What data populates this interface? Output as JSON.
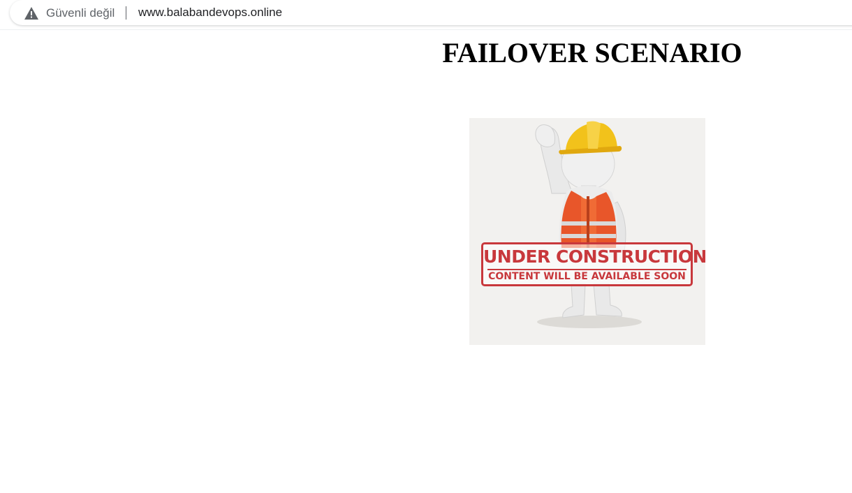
{
  "browser": {
    "security_label": "Güvenli değil",
    "security_icon": "warning-triangle-icon",
    "url": "www.balabandevops.online"
  },
  "page": {
    "title": "FAILOVER SCENARIO",
    "image": {
      "stamp_main": "UNDER CONSTRUCTION",
      "stamp_sub": "CONTENT WILL BE AVAILABLE SOON"
    }
  },
  "colors": {
    "stamp_red": "#c8383c",
    "helmet_yellow": "#f2c21b",
    "vest_orange": "#e8562a",
    "image_background": "#f2f1ef"
  }
}
